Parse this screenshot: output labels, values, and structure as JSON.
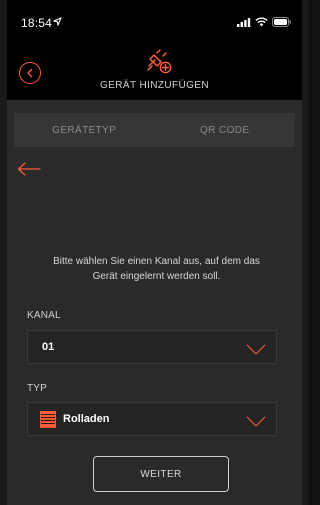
{
  "status_bar": {
    "time": "18:54",
    "location_icon": "location-arrow-icon",
    "signal_icon": "cellular-signal-icon",
    "wifi_icon": "wifi-icon",
    "battery_icon": "battery-icon"
  },
  "header": {
    "title": "GERÄT HINZUFÜGEN",
    "back_icon": "back-circle-icon",
    "device_icon": "add-device-plug-icon"
  },
  "tabs": [
    {
      "label": "GERÄTETYP"
    },
    {
      "label": "QR CODE"
    }
  ],
  "prompt": "Bitte wählen Sie einen Kanal aus, auf dem das Gerät eingelernt werden soll.",
  "kanal": {
    "label": "KANAL",
    "value": "01"
  },
  "typ": {
    "label": "TYP",
    "value": "Rolladen",
    "icon": "roller-shutter-icon"
  },
  "button": {
    "label": "WEITER"
  },
  "colors": {
    "accent": "#ff5a3c",
    "background": "#2a2a2a",
    "header_bg": "#000000"
  }
}
